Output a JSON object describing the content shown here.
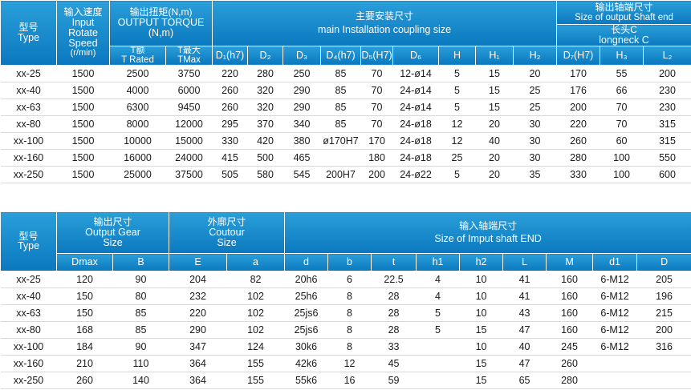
{
  "table1": {
    "header": {
      "type_zh": "型号",
      "type_en": "Type",
      "speed_zh": "输入速度",
      "speed_en": [
        "Input",
        "Rotate",
        "Speed",
        "(r/min)"
      ],
      "torque_zh": "输出扭矩(N,m)",
      "torque_en": [
        "OUTPUT TORQUE",
        "(N,m)"
      ],
      "t_rated_zh": "T额",
      "t_rated_en": "T Rated",
      "t_max_zh": "T最大",
      "t_max_en": "TMax",
      "install_zh": "主要安装尺寸",
      "install_en": "main Installation coupling size",
      "shaft_zh": "输出轴端尺寸",
      "shaft_en": "Size of output Shaft end",
      "longneck_zh": "长头C",
      "longneck_en": "longneck C",
      "cols": [
        "D₁(h7)",
        "D₂",
        "D₃",
        "D₄(h7)",
        "D₅(H7)",
        "D₆",
        "H",
        "H₁",
        "H₂",
        "D₇(H7)",
        "H₃",
        "L₂"
      ]
    },
    "rows": [
      [
        "xx-25",
        "1500",
        "2500",
        "3750",
        "220",
        "280",
        "250",
        "85",
        "70",
        "12-ø14",
        "5",
        "15",
        "20",
        "170",
        "55",
        "200"
      ],
      [
        "xx-40",
        "1500",
        "4000",
        "6000",
        "260",
        "320",
        "290",
        "85",
        "70",
        "24-ø14",
        "5",
        "15",
        "25",
        "176",
        "66",
        "230"
      ],
      [
        "xx-63",
        "1500",
        "6300",
        "9450",
        "260",
        "320",
        "290",
        "85",
        "70",
        "24-ø14",
        "5",
        "15",
        "25",
        "200",
        "70",
        "230"
      ],
      [
        "xx-80",
        "1500",
        "8000",
        "12000",
        "295",
        "370",
        "340",
        "85",
        "70",
        "24-ø18",
        "12",
        "20",
        "30",
        "220",
        "70",
        "315"
      ],
      [
        "xx-100",
        "1500",
        "10000",
        "15000",
        "330",
        "420",
        "380",
        "ø170H7",
        "170",
        "24-ø18",
        "12",
        "40",
        "30",
        "260",
        "60",
        "315"
      ],
      [
        "xx-160",
        "1500",
        "16000",
        "24000",
        "415",
        "500",
        "465",
        "",
        "180",
        "24-ø18",
        "25",
        "20",
        "30",
        "280",
        "100",
        "550"
      ],
      [
        "xx-250",
        "1500",
        "25000",
        "37500",
        "505",
        "580",
        "545",
        "200H7",
        "200",
        "24-ø22",
        "5",
        "20",
        "35",
        "330",
        "100",
        "600"
      ]
    ]
  },
  "table2": {
    "header": {
      "type_zh": "型号",
      "type_en": "Type",
      "gear_zh": "输出尺寸",
      "gear_en": [
        "Output Gear",
        "Size"
      ],
      "contour_zh": "外廓尺寸",
      "contour_en": [
        "Coutour",
        "Size"
      ],
      "input_zh": "输入轴端尺寸",
      "input_en": "Size of Imput shaft END",
      "cols": [
        "Dmax",
        "B",
        "E",
        "a",
        "d",
        "b",
        "t",
        "h1",
        "h2",
        "L",
        "M",
        "d1",
        "D"
      ]
    },
    "rows": [
      [
        "xx-25",
        "120",
        "90",
        "204",
        "82",
        "20h6",
        "6",
        "22.5",
        "4",
        "10",
        "41",
        "160",
        "6-M12",
        "205"
      ],
      [
        "xx-40",
        "150",
        "80",
        "232",
        "102",
        "25h6",
        "8",
        "28",
        "4",
        "10",
        "41",
        "160",
        "6-M12",
        "196"
      ],
      [
        "xx-63",
        "150",
        "85",
        "220",
        "102",
        "25js6",
        "8",
        "28",
        "5",
        "10",
        "43",
        "160",
        "6-M12",
        "215"
      ],
      [
        "xx-80",
        "168",
        "85",
        "290",
        "102",
        "25js6",
        "8",
        "28",
        "5",
        "15",
        "47",
        "160",
        "6-M12",
        "200"
      ],
      [
        "xx-100",
        "184",
        "90",
        "347",
        "124",
        "30k6",
        "8",
        "33",
        "",
        "10",
        "40",
        "245",
        "6-M12",
        "316"
      ],
      [
        "xx-160",
        "210",
        "110",
        "364",
        "155",
        "42k6",
        "12",
        "45",
        "",
        "15",
        "47",
        "260",
        "",
        ""
      ],
      [
        "xx-250",
        "260",
        "140",
        "364",
        "155",
        "55k6",
        "16",
        "59",
        "",
        "15",
        "65",
        "280",
        "",
        ""
      ]
    ]
  }
}
